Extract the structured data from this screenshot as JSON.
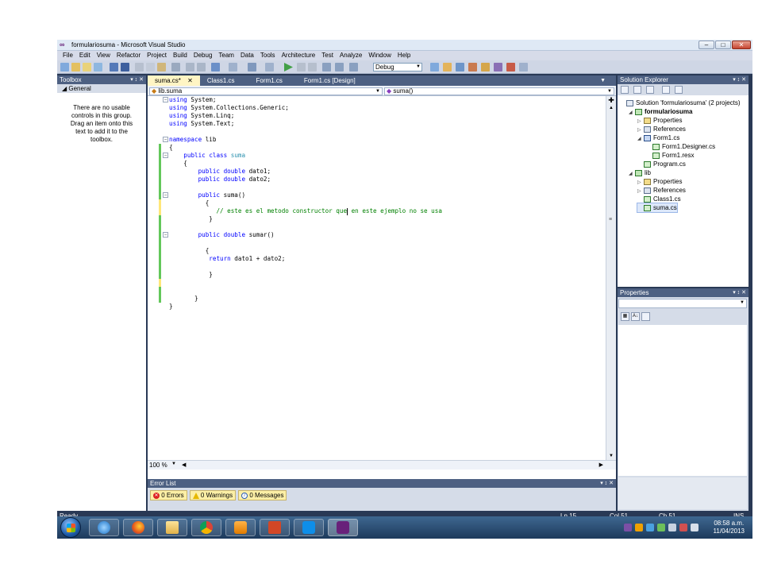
{
  "window": {
    "title": "formulariosuma - Microsoft Visual Studio"
  },
  "menu": [
    "File",
    "Edit",
    "View",
    "Refactor",
    "Project",
    "Build",
    "Debug",
    "Team",
    "Data",
    "Tools",
    "Architecture",
    "Test",
    "Analyze",
    "Window",
    "Help"
  ],
  "toolbar": {
    "configuration": "Debug"
  },
  "toolbox": {
    "title": "Toolbox",
    "controls": "▾ p ✕",
    "group": "◢ General",
    "message": "There are no usable controls in this group. Drag an item onto this text to add it to the toolbox."
  },
  "editor": {
    "tabs": [
      "suma.cs*",
      "Class1.cs",
      "Form1.cs",
      "Form1.cs [Design]"
    ],
    "active_tab_close": "✕",
    "nav_left": "lib.suma",
    "nav_right": "suma()",
    "zoom": "100 %",
    "lines": [
      [
        {
          "t": "using",
          "k": "kw"
        },
        {
          "t": " System;"
        }
      ],
      [
        {
          "t": "using",
          "k": "kw"
        },
        {
          "t": " System.Collections.Generic;"
        }
      ],
      [
        {
          "t": "using",
          "k": "kw"
        },
        {
          "t": " System.Linq;"
        }
      ],
      [
        {
          "t": "using",
          "k": "kw"
        },
        {
          "t": " System.Text;"
        }
      ],
      [],
      [
        {
          "t": "namespace",
          "k": "kw"
        },
        {
          "t": " lib"
        }
      ],
      [
        {
          "t": "{"
        }
      ],
      [
        {
          "t": "    "
        },
        {
          "t": "public",
          "k": "kw"
        },
        {
          "t": " "
        },
        {
          "t": "class",
          "k": "kw"
        },
        {
          "t": " "
        },
        {
          "t": "suma",
          "k": "ty"
        }
      ],
      [
        {
          "t": "    {"
        }
      ],
      [
        {
          "t": "        "
        },
        {
          "t": "public",
          "k": "kw"
        },
        {
          "t": " "
        },
        {
          "t": "double",
          "k": "kw"
        },
        {
          "t": " dato1;"
        }
      ],
      [
        {
          "t": "        "
        },
        {
          "t": "public",
          "k": "kw"
        },
        {
          "t": " "
        },
        {
          "t": "double",
          "k": "kw"
        },
        {
          "t": " dato2;"
        }
      ],
      [],
      [
        {
          "t": "        "
        },
        {
          "t": "public",
          "k": "kw"
        },
        {
          "t": " suma()"
        }
      ],
      [
        {
          "t": "          {"
        }
      ],
      [
        {
          "t": "             "
        },
        {
          "t": "// este es el metodo constructor que",
          "k": "cm"
        },
        {
          "t": "|",
          "k": "caret"
        },
        {
          "t": " en este ejemplo no se usa",
          "k": "cm"
        }
      ],
      [
        {
          "t": "           }"
        }
      ],
      [],
      [
        {
          "t": "        "
        },
        {
          "t": "public",
          "k": "kw"
        },
        {
          "t": " "
        },
        {
          "t": "double",
          "k": "kw"
        },
        {
          "t": " sumar()"
        }
      ],
      [],
      [
        {
          "t": "          {"
        }
      ],
      [
        {
          "t": "           "
        },
        {
          "t": "return",
          "k": "kw"
        },
        {
          "t": " dato1 + dato2;"
        }
      ],
      [],
      [
        {
          "t": "           }"
        }
      ],
      [],
      [],
      [
        {
          "t": "       }"
        }
      ],
      [
        {
          "t": "}"
        }
      ]
    ]
  },
  "error_list": {
    "title": "Error List",
    "errors": "0 Errors",
    "warnings": "0 Warnings",
    "messages": "0 Messages"
  },
  "solution_explorer": {
    "title": "Solution Explorer",
    "items": [
      {
        "label": "Solution 'formulariosuma' (2 projects)",
        "icon": "sol",
        "indent": 0,
        "exp": ""
      },
      {
        "label": "formulariosuma",
        "icon": "proj",
        "indent": 1,
        "exp": "◢",
        "bold": true
      },
      {
        "label": "Properties",
        "icon": "folder",
        "indent": 2,
        "exp": "▷"
      },
      {
        "label": "References",
        "icon": "refs",
        "indent": 2,
        "exp": "▷"
      },
      {
        "label": "Form1.cs",
        "icon": "form",
        "indent": 2,
        "exp": "◢"
      },
      {
        "label": "Form1.Designer.cs",
        "icon": "cs",
        "indent": 3,
        "exp": ""
      },
      {
        "label": "Form1.resx",
        "icon": "cs",
        "indent": 3,
        "exp": ""
      },
      {
        "label": "Program.cs",
        "icon": "cs",
        "indent": 2,
        "exp": ""
      },
      {
        "label": "lib",
        "icon": "proj",
        "indent": 1,
        "exp": "◢"
      },
      {
        "label": "Properties",
        "icon": "folder",
        "indent": 2,
        "exp": "▷"
      },
      {
        "label": "References",
        "icon": "refs",
        "indent": 2,
        "exp": "▷"
      },
      {
        "label": "Class1.cs",
        "icon": "cs",
        "indent": 2,
        "exp": ""
      },
      {
        "label": "suma.cs",
        "icon": "cs",
        "indent": 2,
        "exp": "",
        "selected": true
      }
    ]
  },
  "properties": {
    "title": "Properties"
  },
  "status": {
    "ready": "Ready",
    "ln": "Ln 15",
    "col": "Col 51",
    "ch": "Ch 51",
    "mode": "INS"
  },
  "clock": {
    "time": "08:58 a.m.",
    "date": "11/04/2013"
  }
}
